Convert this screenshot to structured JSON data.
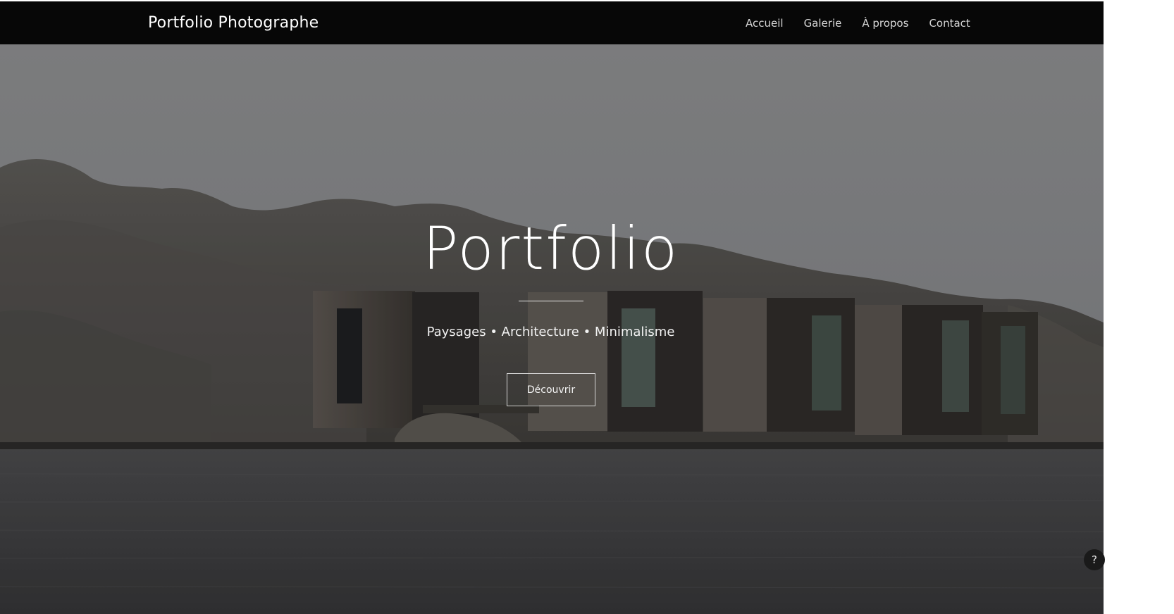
{
  "navbar": {
    "brand": "Portfolio Photographe",
    "links": [
      {
        "label": "Accueil"
      },
      {
        "label": "Galerie"
      },
      {
        "label": "À propos"
      },
      {
        "label": "Contact"
      }
    ]
  },
  "hero": {
    "title": "Portfolio",
    "subtitle": "Paysages • Architecture • Minimalisme",
    "cta_label": "Découvrir"
  },
  "help": {
    "label": "?"
  },
  "colors": {
    "navbar_bg": "#070707",
    "sky": "#8b8c8e",
    "water": "#3f3f41",
    "text": "#ffffff"
  },
  "icons": {
    "help": "question-mark-icon"
  }
}
